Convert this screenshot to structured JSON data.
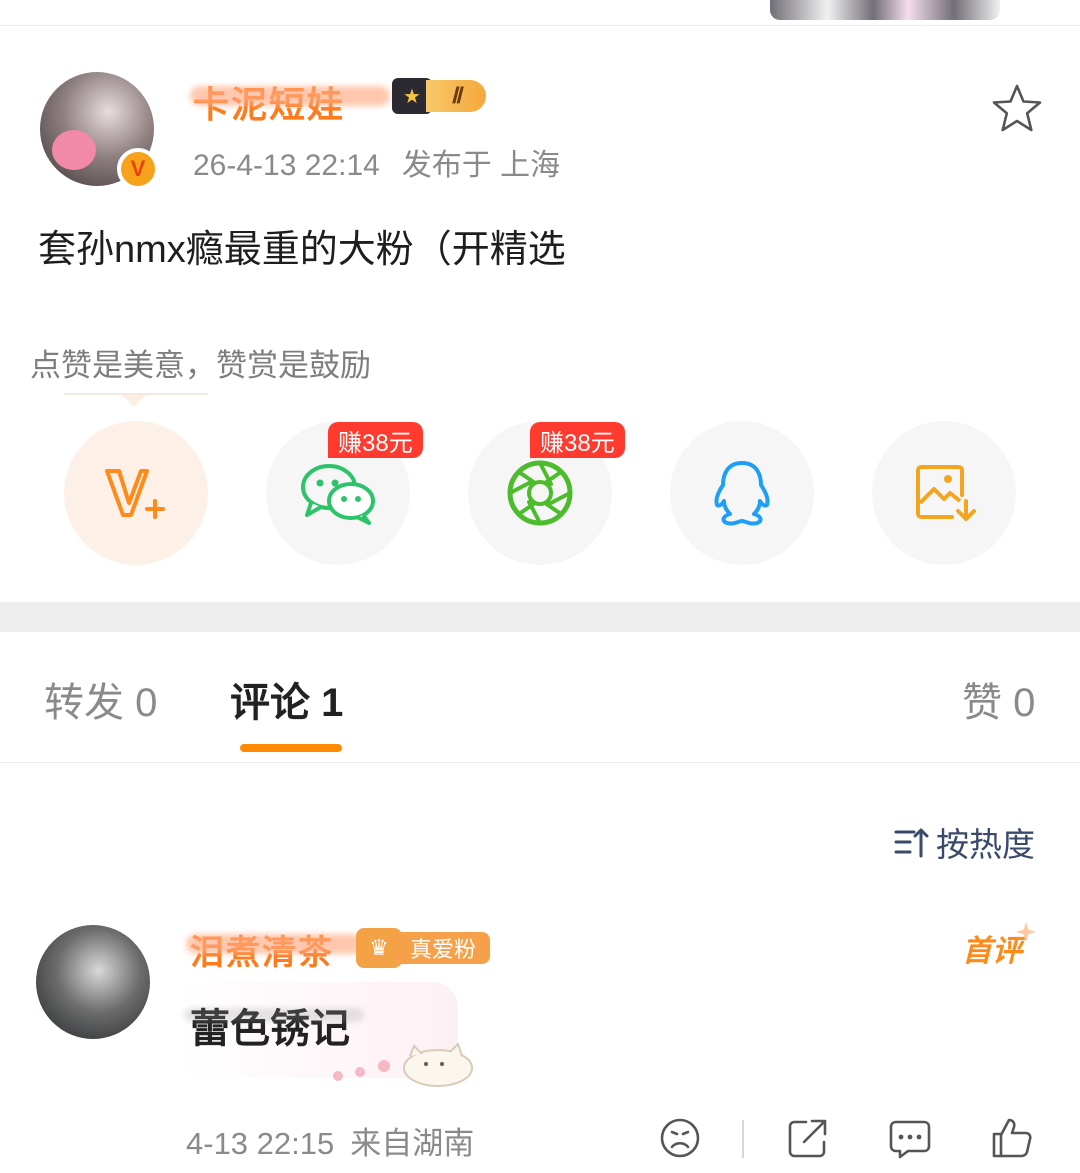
{
  "post": {
    "username": "卡泥短娃",
    "level": "Ⅱ",
    "time": "26-4-13 22:14",
    "location": "发布于 上海",
    "text": "套孙nmx瘾最重的大粉（开精选",
    "vip_mark": "V"
  },
  "reward": {
    "tip": "点赞是美意，赞赏是鼓励",
    "share": [
      {
        "name": "v-plus",
        "icon": "v-plus-icon"
      },
      {
        "name": "wechat",
        "icon": "wechat-icon",
        "tag": "赚38元"
      },
      {
        "name": "moments",
        "icon": "moments-shutter-icon",
        "tag": "赚38元"
      },
      {
        "name": "qq",
        "icon": "qq-penguin-icon"
      },
      {
        "name": "save-image",
        "icon": "image-download-icon"
      }
    ]
  },
  "tabs": {
    "repost": "转发 0",
    "comments": "评论 1",
    "likes": "赞 0"
  },
  "sort": {
    "label": "按热度"
  },
  "comment": {
    "username": "泪煮清茶",
    "fan_badge": "真爱粉",
    "first_label": "首评",
    "text": "蕾色锈记",
    "time": "4-13 22:15",
    "location": "来自湖南"
  },
  "colors": {
    "accent": "#ff8c00",
    "username": "#ff7a1a",
    "earn_tag": "#ff3b2f",
    "wechat_green": "#2dc36a",
    "qq_blue": "#1e9ef5"
  }
}
